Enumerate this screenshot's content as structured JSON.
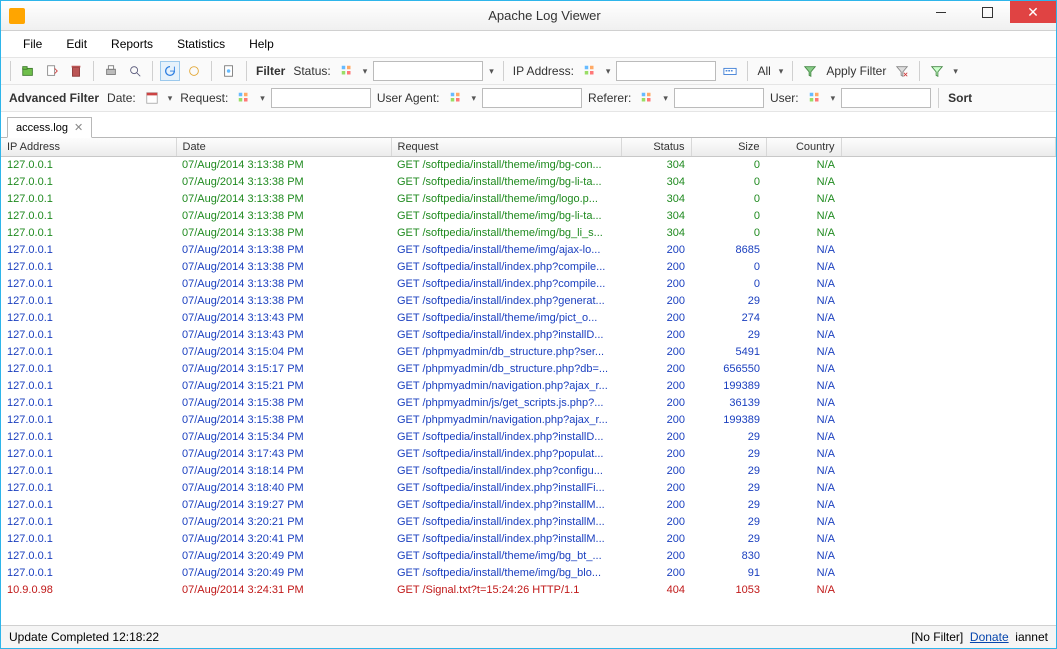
{
  "window": {
    "title": "Apache Log Viewer"
  },
  "menu": [
    "File",
    "Edit",
    "Reports",
    "Statistics",
    "Help"
  ],
  "toolbar": {
    "filter_label": "Filter",
    "status_label": "Status:",
    "ip_label": "IP Address:",
    "all_label": "All",
    "apply_label": "Apply Filter"
  },
  "filterbar": {
    "adv_label": "Advanced Filter",
    "date_label": "Date:",
    "request_label": "Request:",
    "ua_label": "User Agent:",
    "referer_label": "Referer:",
    "user_label": "User:",
    "sort_label": "Sort"
  },
  "tab": {
    "name": "access.log"
  },
  "columns": [
    "IP Address",
    "Date",
    "Request",
    "Status",
    "Size",
    "Country"
  ],
  "rows": [
    {
      "ip": "127.0.0.1",
      "date": "07/Aug/2014 3:13:38 PM",
      "req": "GET /softpedia/install/theme/img/bg-con...",
      "status": "304",
      "size": "0",
      "country": "N/A",
      "c": "green"
    },
    {
      "ip": "127.0.0.1",
      "date": "07/Aug/2014 3:13:38 PM",
      "req": "GET /softpedia/install/theme/img/bg-li-ta...",
      "status": "304",
      "size": "0",
      "country": "N/A",
      "c": "green"
    },
    {
      "ip": "127.0.0.1",
      "date": "07/Aug/2014 3:13:38 PM",
      "req": "GET /softpedia/install/theme/img/logo.p...",
      "status": "304",
      "size": "0",
      "country": "N/A",
      "c": "green"
    },
    {
      "ip": "127.0.0.1",
      "date": "07/Aug/2014 3:13:38 PM",
      "req": "GET /softpedia/install/theme/img/bg-li-ta...",
      "status": "304",
      "size": "0",
      "country": "N/A",
      "c": "green"
    },
    {
      "ip": "127.0.0.1",
      "date": "07/Aug/2014 3:13:38 PM",
      "req": "GET /softpedia/install/theme/img/bg_li_s...",
      "status": "304",
      "size": "0",
      "country": "N/A",
      "c": "green"
    },
    {
      "ip": "127.0.0.1",
      "date": "07/Aug/2014 3:13:38 PM",
      "req": "GET /softpedia/install/theme/img/ajax-lo...",
      "status": "200",
      "size": "8685",
      "country": "N/A",
      "c": "blue"
    },
    {
      "ip": "127.0.0.1",
      "date": "07/Aug/2014 3:13:38 PM",
      "req": "GET /softpedia/install/index.php?compile...",
      "status": "200",
      "size": "0",
      "country": "N/A",
      "c": "blue"
    },
    {
      "ip": "127.0.0.1",
      "date": "07/Aug/2014 3:13:38 PM",
      "req": "GET /softpedia/install/index.php?compile...",
      "status": "200",
      "size": "0",
      "country": "N/A",
      "c": "blue"
    },
    {
      "ip": "127.0.0.1",
      "date": "07/Aug/2014 3:13:38 PM",
      "req": "GET /softpedia/install/index.php?generat...",
      "status": "200",
      "size": "29",
      "country": "N/A",
      "c": "blue"
    },
    {
      "ip": "127.0.0.1",
      "date": "07/Aug/2014 3:13:43 PM",
      "req": "GET /softpedia/install/theme/img/pict_o...",
      "status": "200",
      "size": "274",
      "country": "N/A",
      "c": "blue"
    },
    {
      "ip": "127.0.0.1",
      "date": "07/Aug/2014 3:13:43 PM",
      "req": "GET /softpedia/install/index.php?installD...",
      "status": "200",
      "size": "29",
      "country": "N/A",
      "c": "blue"
    },
    {
      "ip": "127.0.0.1",
      "date": "07/Aug/2014 3:15:04 PM",
      "req": "GET /phpmyadmin/db_structure.php?ser...",
      "status": "200",
      "size": "5491",
      "country": "N/A",
      "c": "blue"
    },
    {
      "ip": "127.0.0.1",
      "date": "07/Aug/2014 3:15:17 PM",
      "req": "GET /phpmyadmin/db_structure.php?db=...",
      "status": "200",
      "size": "656550",
      "country": "N/A",
      "c": "blue"
    },
    {
      "ip": "127.0.0.1",
      "date": "07/Aug/2014 3:15:21 PM",
      "req": "GET /phpmyadmin/navigation.php?ajax_r...",
      "status": "200",
      "size": "199389",
      "country": "N/A",
      "c": "blue"
    },
    {
      "ip": "127.0.0.1",
      "date": "07/Aug/2014 3:15:38 PM",
      "req": "GET /phpmyadmin/js/get_scripts.js.php?...",
      "status": "200",
      "size": "36139",
      "country": "N/A",
      "c": "blue"
    },
    {
      "ip": "127.0.0.1",
      "date": "07/Aug/2014 3:15:38 PM",
      "req": "GET /phpmyadmin/navigation.php?ajax_r...",
      "status": "200",
      "size": "199389",
      "country": "N/A",
      "c": "blue"
    },
    {
      "ip": "127.0.0.1",
      "date": "07/Aug/2014 3:15:34 PM",
      "req": "GET /softpedia/install/index.php?installD...",
      "status": "200",
      "size": "29",
      "country": "N/A",
      "c": "blue"
    },
    {
      "ip": "127.0.0.1",
      "date": "07/Aug/2014 3:17:43 PM",
      "req": "GET /softpedia/install/index.php?populat...",
      "status": "200",
      "size": "29",
      "country": "N/A",
      "c": "blue"
    },
    {
      "ip": "127.0.0.1",
      "date": "07/Aug/2014 3:18:14 PM",
      "req": "GET /softpedia/install/index.php?configu...",
      "status": "200",
      "size": "29",
      "country": "N/A",
      "c": "blue"
    },
    {
      "ip": "127.0.0.1",
      "date": "07/Aug/2014 3:18:40 PM",
      "req": "GET /softpedia/install/index.php?installFi...",
      "status": "200",
      "size": "29",
      "country": "N/A",
      "c": "blue"
    },
    {
      "ip": "127.0.0.1",
      "date": "07/Aug/2014 3:19:27 PM",
      "req": "GET /softpedia/install/index.php?installM...",
      "status": "200",
      "size": "29",
      "country": "N/A",
      "c": "blue"
    },
    {
      "ip": "127.0.0.1",
      "date": "07/Aug/2014 3:20:21 PM",
      "req": "GET /softpedia/install/index.php?installM...",
      "status": "200",
      "size": "29",
      "country": "N/A",
      "c": "blue"
    },
    {
      "ip": "127.0.0.1",
      "date": "07/Aug/2014 3:20:41 PM",
      "req": "GET /softpedia/install/index.php?installM...",
      "status": "200",
      "size": "29",
      "country": "N/A",
      "c": "blue"
    },
    {
      "ip": "127.0.0.1",
      "date": "07/Aug/2014 3:20:49 PM",
      "req": "GET /softpedia/install/theme/img/bg_bt_...",
      "status": "200",
      "size": "830",
      "country": "N/A",
      "c": "blue"
    },
    {
      "ip": "127.0.0.1",
      "date": "07/Aug/2014 3:20:49 PM",
      "req": "GET /softpedia/install/theme/img/bg_blo...",
      "status": "200",
      "size": "91",
      "country": "N/A",
      "c": "blue"
    },
    {
      "ip": "10.9.0.98",
      "date": "07/Aug/2014 3:24:31 PM",
      "req": "GET /Signal.txt?t=15:24:26 HTTP/1.1",
      "status": "404",
      "size": "1053",
      "country": "N/A",
      "c": "red"
    }
  ],
  "colors": {
    "blue": "#1a3fbf",
    "green": "#1f8a1f",
    "red": "#c01818"
  },
  "statusbar": {
    "left": "Update Completed 12:18:22",
    "filter": "[No Filter]",
    "donate": "Donate",
    "brand": "iannet"
  }
}
